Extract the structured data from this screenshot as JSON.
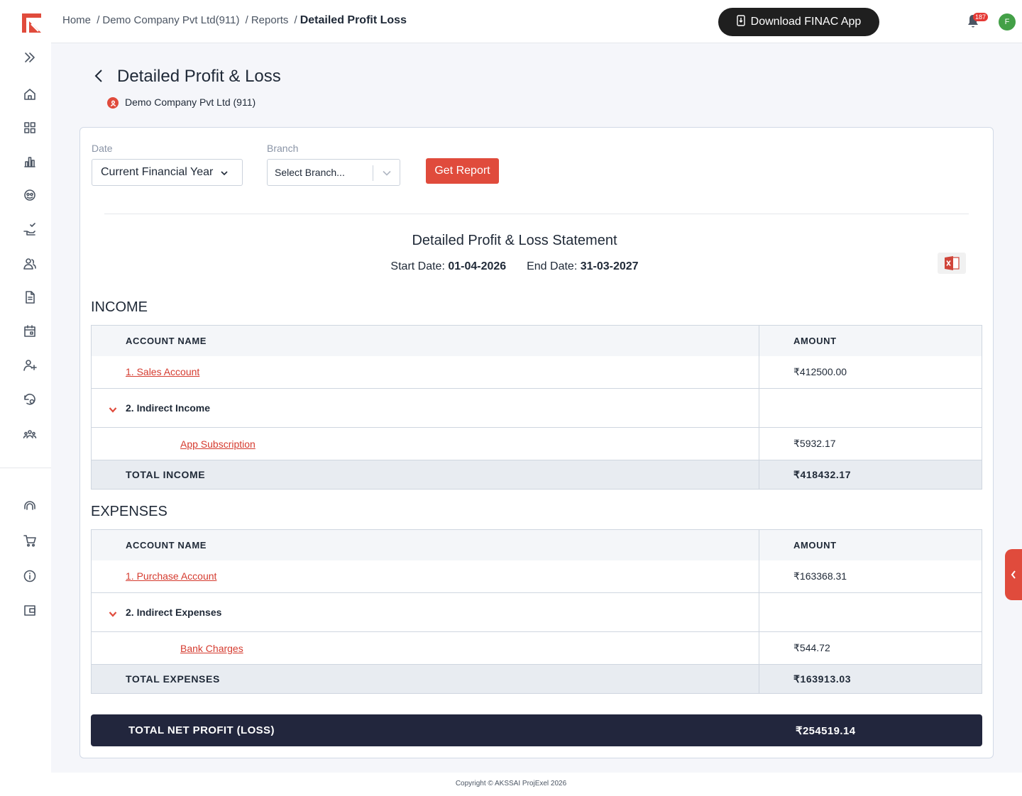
{
  "breadcrumb": {
    "home": "Home",
    "company": "Demo Company Pvt Ltd(911)",
    "reports": "Reports",
    "current": "Detailed Profit Loss",
    "sep": "/"
  },
  "header": {
    "download_label": "Download FINAC App",
    "notification_count": "187",
    "avatar_initial": "F"
  },
  "page": {
    "title": "Detailed Profit & Loss",
    "company": "Demo Company Pvt Ltd (911)"
  },
  "filters": {
    "date_label": "Date",
    "date_value": "Current Financial Year",
    "branch_label": "Branch",
    "branch_placeholder": "Select Branch...",
    "get_report_label": "Get Report"
  },
  "statement": {
    "title": "Detailed Profit & Loss Statement",
    "start_label": "Start Date:",
    "start_date": "01-04-2026",
    "end_label": "End Date:",
    "end_date": "31-03-2027"
  },
  "income": {
    "title": "INCOME",
    "col_name": "ACCOUNT NAME",
    "col_amount": "AMOUNT",
    "rows": [
      {
        "name": "1. Sales Account",
        "amount": "₹412500.00"
      },
      {
        "name": "2. Indirect Income",
        "amount": ""
      },
      {
        "name": "App Subscription",
        "amount": "₹5932.17"
      }
    ],
    "total_label": "TOTAL INCOME",
    "total_value": "₹418432.17"
  },
  "expenses": {
    "title": "EXPENSES",
    "col_name": "ACCOUNT NAME",
    "col_amount": "AMOUNT",
    "rows": [
      {
        "name": "1. Purchase Account",
        "amount": "₹163368.31"
      },
      {
        "name": "2. Indirect Expenses",
        "amount": ""
      },
      {
        "name": "Bank Charges",
        "amount": "₹544.72"
      }
    ],
    "total_label": "TOTAL EXPENSES",
    "total_value": "₹163913.03"
  },
  "net": {
    "label": "TOTAL NET PROFIT (LOSS)",
    "value": "₹254519.14"
  },
  "footer": {
    "copyright": "Copyright © AKSSAI ProjExel 2026"
  },
  "colors": {
    "accent": "#e04b3c",
    "dark": "#22263d"
  },
  "sidebar_icons": [
    "expand-icon",
    "home-icon",
    "dashboard-icon",
    "reports-icon",
    "accounts-icon",
    "payments-icon",
    "contacts-icon",
    "documents-icon",
    "calendar-icon",
    "add-user-icon",
    "settings-history-icon",
    "team-icon",
    "support-icon",
    "cart-icon",
    "info-icon",
    "wallet-icon"
  ]
}
